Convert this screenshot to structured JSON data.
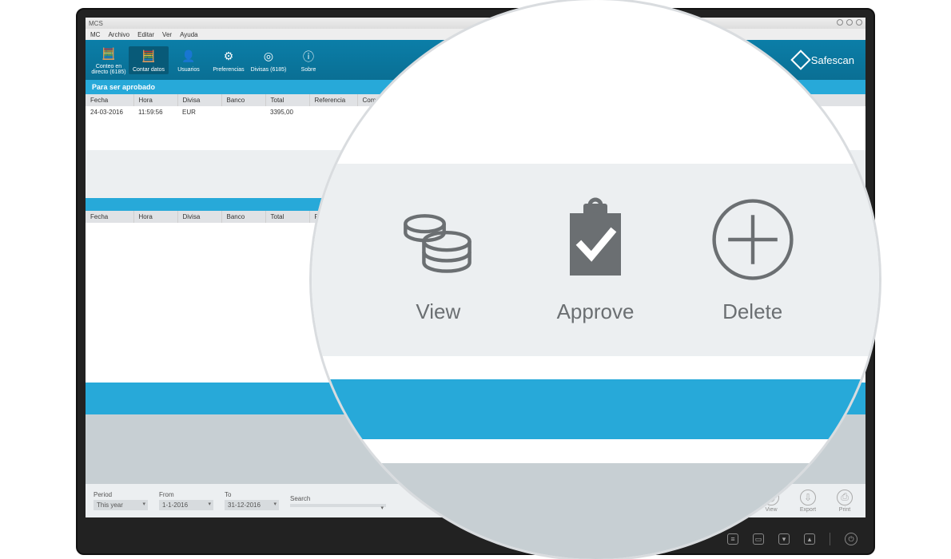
{
  "titlebar": {
    "app_name": "MCS"
  },
  "menubar": {
    "items": [
      "MC",
      "Archivo",
      "Editar",
      "Ver",
      "Ayuda"
    ]
  },
  "toolbar": {
    "items": [
      {
        "label": "Conteo en directo (6185)",
        "name": "tool-live-count"
      },
      {
        "label": "Contar datos",
        "name": "tool-count-data",
        "active": true
      },
      {
        "label": "Usuarios",
        "name": "tool-users"
      },
      {
        "label": "Preferencias",
        "name": "tool-preferences"
      },
      {
        "label": "Divisas (6185)",
        "name": "tool-currencies"
      },
      {
        "label": "Sobre",
        "name": "tool-about"
      }
    ],
    "brand": "Safescan"
  },
  "section": {
    "pending_title": "Para ser aprobado"
  },
  "columns": [
    "Fecha",
    "Hora",
    "Divisa",
    "Banco",
    "Total",
    "Referencia",
    "Comentario"
  ],
  "rows": [
    {
      "fecha": "24-03-2016",
      "hora": "11:59:56",
      "divisa": "EUR",
      "banco": "",
      "total": "3395,00",
      "referencia": "",
      "comentario": ""
    }
  ],
  "mini_actions": {
    "view": "View",
    "approve": "Approve",
    "delete": "Delete"
  },
  "footer": {
    "period_label": "Period",
    "period_value": "This year",
    "from_label": "From",
    "from_value": "1-1-2016",
    "to_label": "To",
    "to_value": "31-12-2016",
    "search_label": "Search",
    "export_label": "Export",
    "print_label": "Print",
    "view_label": "View"
  },
  "zoom": {
    "view": "View",
    "approve": "Approve",
    "delete": "Delete"
  }
}
